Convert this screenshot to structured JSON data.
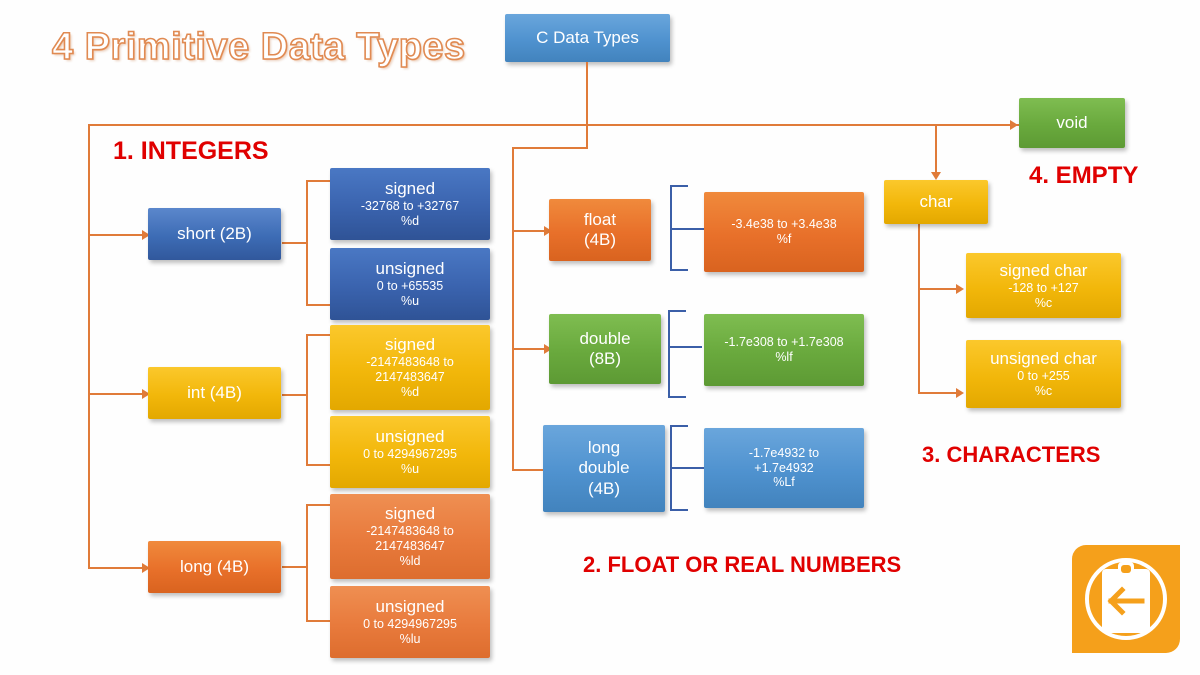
{
  "title": "4 Primitive Data Types",
  "root": {
    "label": "C Data Types"
  },
  "sections": [
    {
      "id": "integers",
      "label": "1. INTEGERS"
    },
    {
      "id": "floats",
      "label": "2. FLOAT OR REAL NUMBERS"
    },
    {
      "id": "characters",
      "label": "3. CHARACTERS"
    },
    {
      "id": "empty",
      "label": "4. EMPTY"
    }
  ],
  "integers": {
    "short": {
      "label": "short (2B)",
      "signed": {
        "title": "signed",
        "range": "-32768 to +32767",
        "format": "%d"
      },
      "unsigned": {
        "title": "unsigned",
        "range": "0 to +65535",
        "format": "%u"
      }
    },
    "int": {
      "label": "int (4B)",
      "signed": {
        "title": "signed",
        "range_l1": "-2147483648 to",
        "range_l2": "2147483647",
        "format": "%d"
      },
      "unsigned": {
        "title": "unsigned",
        "range": "0 to 4294967295",
        "format": "%u"
      }
    },
    "long": {
      "label": "long (4B)",
      "signed": {
        "title": "signed",
        "range_l1": "-2147483648 to",
        "range_l2": "2147483647",
        "format": "%ld"
      },
      "unsigned": {
        "title": "unsigned",
        "range": "0 to 4294967295",
        "format": "%lu"
      }
    }
  },
  "floats": {
    "float": {
      "name": "float",
      "size": "(4B)",
      "range": "-3.4e38 to +3.4e38",
      "format": "%f"
    },
    "double": {
      "name": "double",
      "size": "(8B)",
      "range": "-1.7e308 to +1.7e308",
      "format": "%lf"
    },
    "long_double": {
      "name_l1": "long",
      "name_l2": "double",
      "size": "(4B)",
      "range_l1": "-1.7e4932 to",
      "range_l2": "+1.7e4932",
      "format": "%Lf"
    }
  },
  "characters": {
    "char": {
      "label": "char"
    },
    "signed_char": {
      "title": "signed char",
      "range": "-128 to +127",
      "format": "%c"
    },
    "unsigned_char": {
      "title": "unsigned char",
      "range": "0 to +255",
      "format": "%c"
    }
  },
  "empty": {
    "void": {
      "label": "void"
    }
  },
  "logo": {
    "name": "clipboard-back-icon"
  },
  "colors": {
    "accent_orange": "#e07b39",
    "section_red": "#e00000",
    "blue": "#3d6cb5",
    "light_blue": "#4f92cf",
    "yellow": "#f2b70a",
    "orange": "#e8702a",
    "green": "#69a93d",
    "brace_blue": "#3b5fa8"
  }
}
